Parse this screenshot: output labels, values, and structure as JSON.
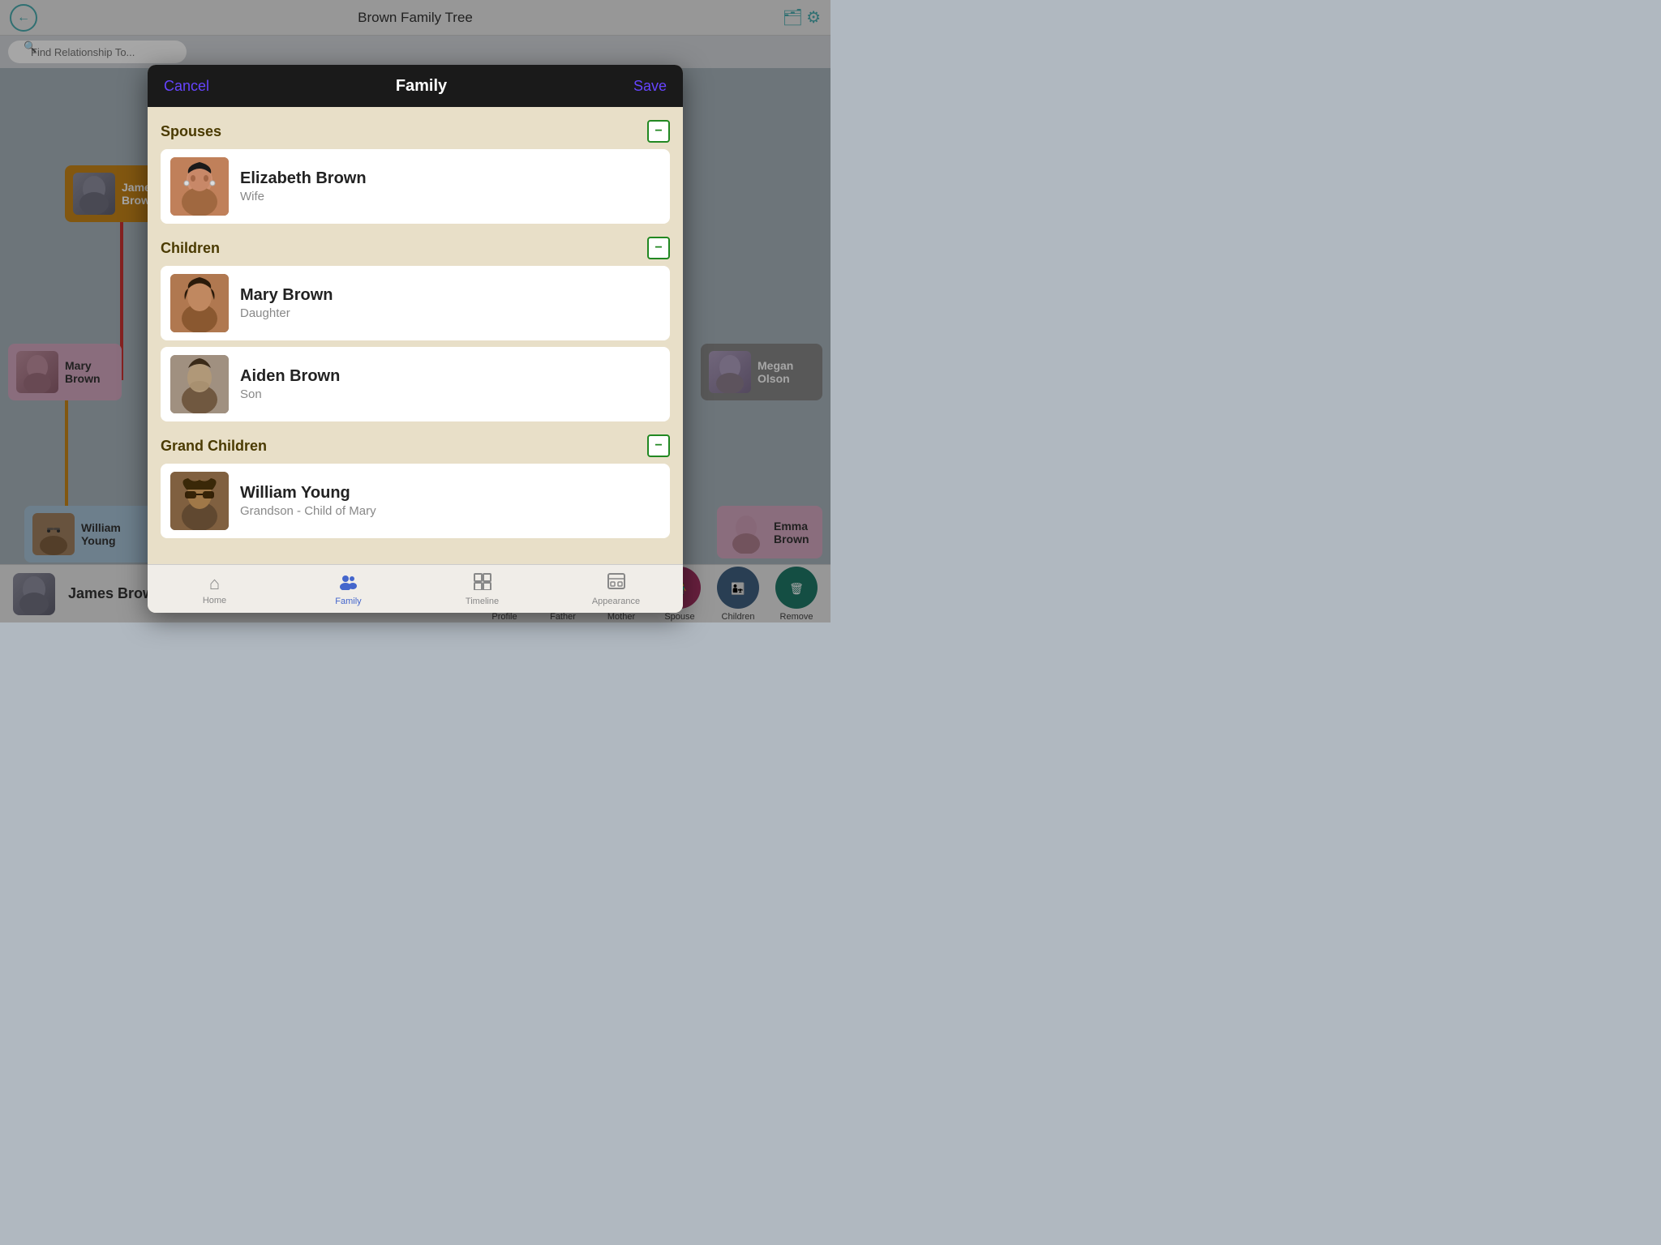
{
  "app": {
    "title": "Brown Family Tree"
  },
  "header": {
    "back_label": "←",
    "search_placeholder": "Find Relationship To..."
  },
  "modal": {
    "cancel_label": "Cancel",
    "title": "Family",
    "save_label": "Save",
    "sections": [
      {
        "id": "spouses",
        "title": "Spouses",
        "members": [
          {
            "name": "Elizabeth Brown",
            "relation": "Wife"
          }
        ]
      },
      {
        "id": "children",
        "title": "Children",
        "members": [
          {
            "name": "Mary Brown",
            "relation": "Daughter"
          },
          {
            "name": "Aiden Brown",
            "relation": "Son"
          }
        ]
      },
      {
        "id": "grandchildren",
        "title": "Grand Children",
        "members": [
          {
            "name": "William Young",
            "relation": "Grandson - Child of Mary"
          }
        ]
      }
    ],
    "tabs": [
      {
        "id": "home",
        "label": "Home",
        "icon": "⌂"
      },
      {
        "id": "family",
        "label": "Family",
        "icon": "👥",
        "active": true
      },
      {
        "id": "timeline",
        "label": "Timeline",
        "icon": "⊞"
      },
      {
        "id": "appearance",
        "label": "Appearance",
        "icon": "⊟"
      }
    ]
  },
  "tree": {
    "nodes": [
      {
        "id": "james",
        "name": "James Brown"
      },
      {
        "id": "mary",
        "name": "Mary Brown"
      },
      {
        "id": "william",
        "name": "William Young"
      },
      {
        "id": "megan",
        "name": "Megan Olson"
      },
      {
        "id": "emma",
        "name": "Emma Brown"
      }
    ]
  },
  "bottom_bar": {
    "person_name": "James Brown",
    "actions": [
      {
        "id": "profile",
        "label": "Profile",
        "icon": "✏️"
      },
      {
        "id": "father",
        "label": "Father",
        "icon": "👴"
      },
      {
        "id": "mother",
        "label": "Mother",
        "icon": "👩"
      },
      {
        "id": "spouse",
        "label": "Spouse",
        "icon": "👫"
      },
      {
        "id": "children",
        "label": "Children",
        "icon": "👨‍👧"
      },
      {
        "id": "remove",
        "label": "Remove",
        "icon": "🗑"
      }
    ]
  }
}
